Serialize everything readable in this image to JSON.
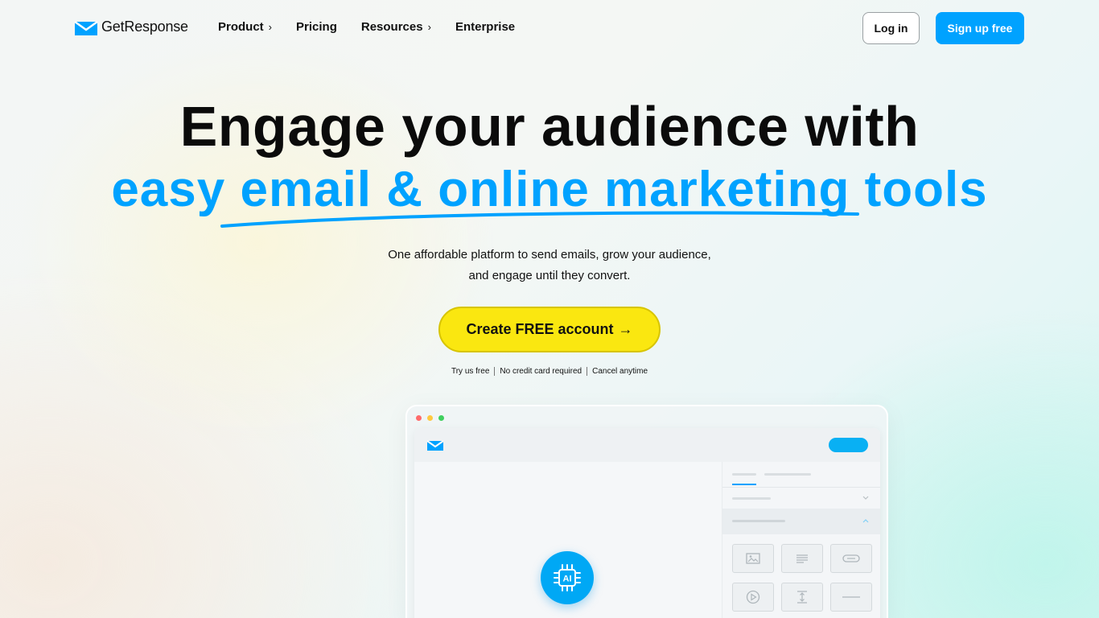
{
  "nav": {
    "logo_text": "GetResponse",
    "links": [
      {
        "label": "Product",
        "chevron": "›"
      },
      {
        "label": "Pricing"
      },
      {
        "label": "Resources",
        "chevron": "›"
      },
      {
        "label": "Enterprise"
      }
    ],
    "login_label": "Log in",
    "signup_label": "Sign up free"
  },
  "hero": {
    "headline_line1": "Engage your audience with",
    "headline_line2": "easy email & online marketing tools",
    "sub_line1": "One affordable platform to send emails, grow your audience,",
    "sub_line2": "and engage until they convert.",
    "cta_label": "Create FREE account",
    "cta_arrow": "→",
    "perks": [
      "Try us free",
      "No credit card required",
      "Cancel anytime"
    ]
  },
  "mockup": {
    "ai_label": "AI"
  },
  "colors": {
    "brand_blue": "#00a2ff",
    "cta_yellow": "#fae710",
    "text": "#0b0b0b"
  },
  "icons": [
    "envelope-logo-icon",
    "chevron-right-icon",
    "arrow-right-icon",
    "image-icon",
    "text-icon",
    "link-icon",
    "video-icon",
    "spacer-icon",
    "divider-icon",
    "ai-chip-icon"
  ]
}
